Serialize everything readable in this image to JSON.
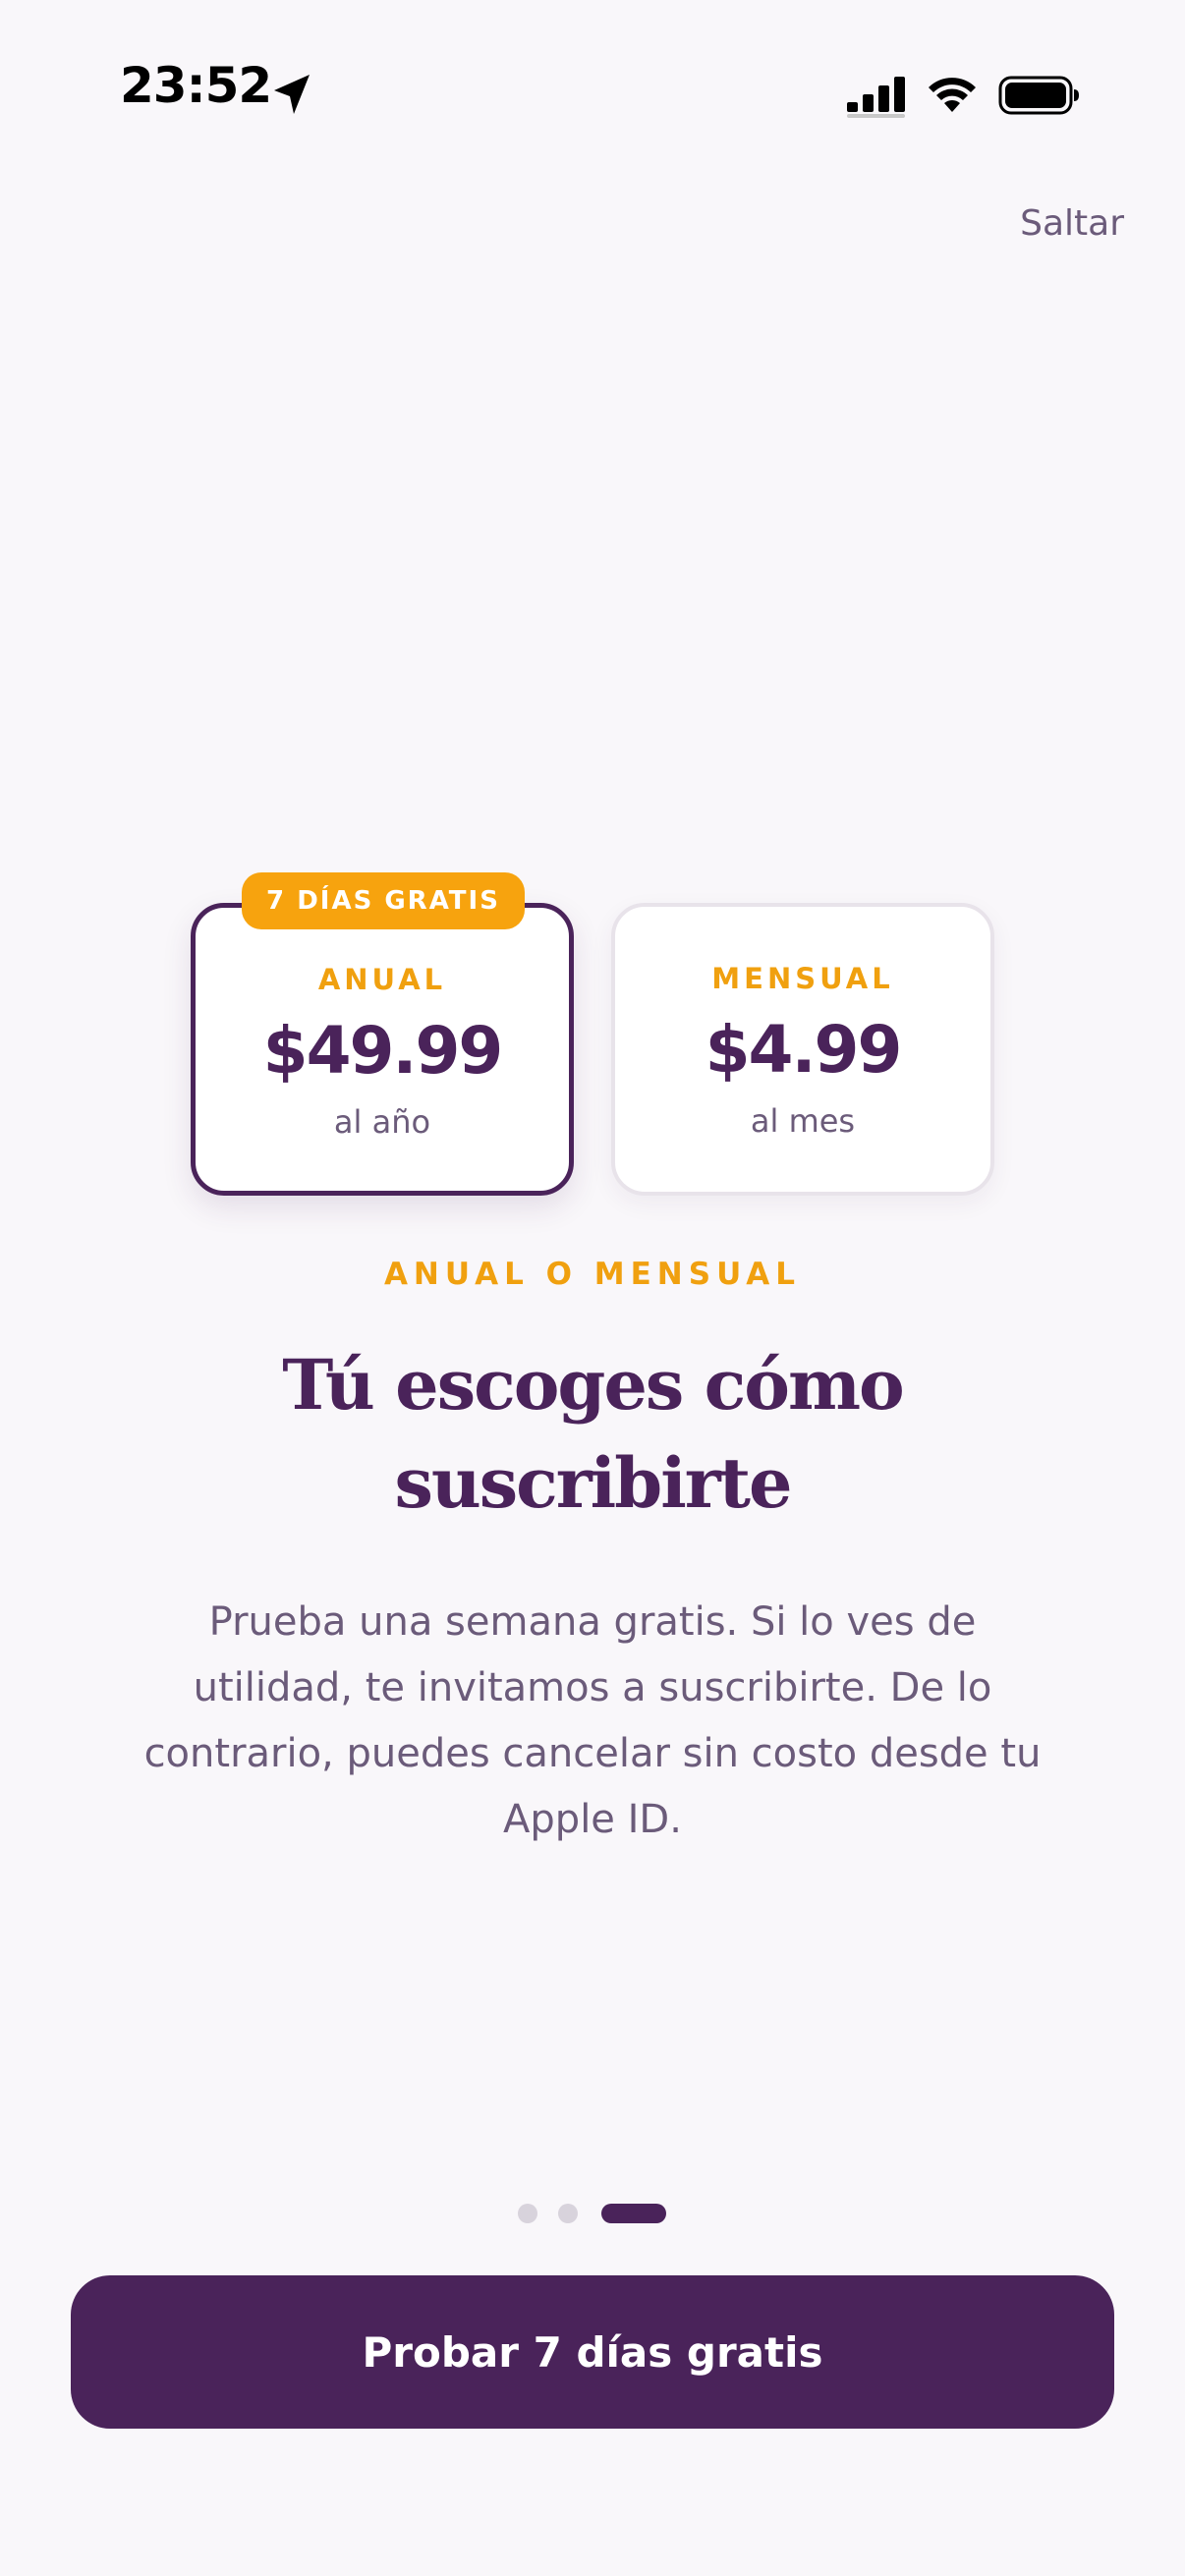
{
  "status_bar": {
    "time": "23:52",
    "icons": [
      "location-arrow-icon",
      "cellular-signal-icon",
      "wifi-icon",
      "battery-icon"
    ]
  },
  "header": {
    "skip_label": "Saltar"
  },
  "plans": [
    {
      "badge": "7 DÍAS GRATIS",
      "label": "ANUAL",
      "price": "$49.99",
      "period": "al año",
      "selected": true
    },
    {
      "label": "MENSUAL",
      "price": "$4.99",
      "period": "al mes",
      "selected": false
    }
  ],
  "content": {
    "eyebrow": "ANUAL O MENSUAL",
    "headline": "Tú escoges cómo suscribirte",
    "body": "Prueba una semana gratis. Si lo ves de utilidad, te invitamos a suscribirte. De lo contrario, puedes cancelar sin costo desde tu Apple ID."
  },
  "pagination": {
    "total": 3,
    "current": 3
  },
  "cta": {
    "label": "Probar 7 días gratis"
  },
  "colors": {
    "primary": "#4A235A",
    "accent": "#F7A30E",
    "background": "#F9F7FA",
    "muted_text": "#6B5B7A"
  }
}
